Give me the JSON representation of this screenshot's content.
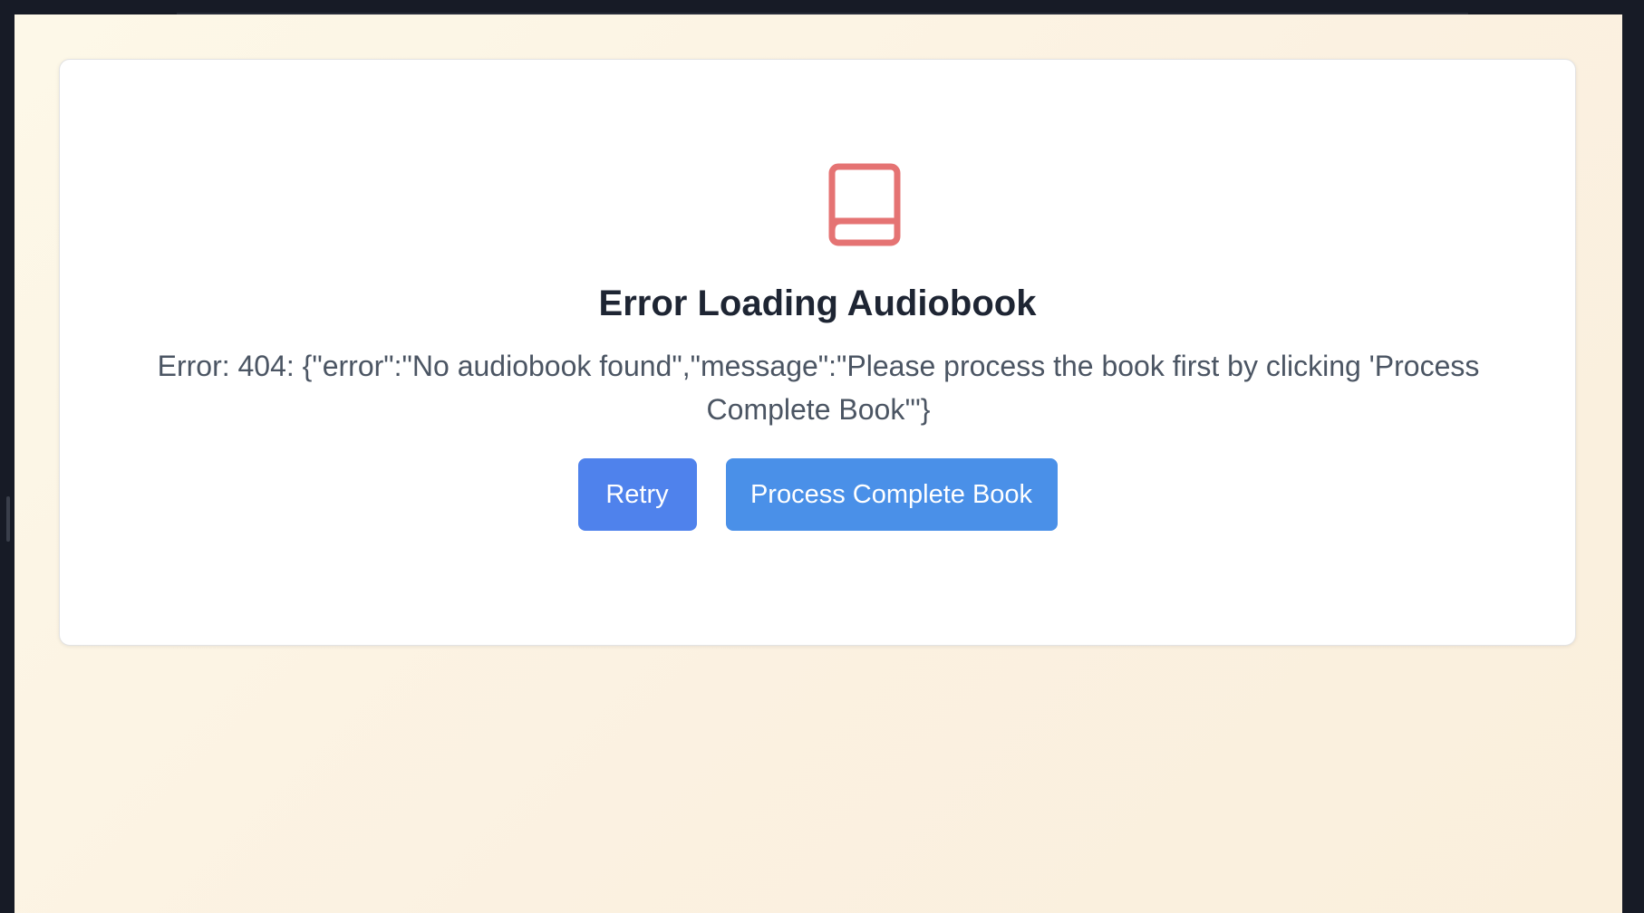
{
  "error_panel": {
    "icon": "book-icon",
    "icon_color": "#e57373",
    "title": "Error Loading Audiobook",
    "message": "Error: 404: {\"error\":\"No audiobook found\",\"message\":\"Please process the book first by clicking 'Process Complete Book'\"}"
  },
  "actions": {
    "retry_label": "Retry",
    "process_label": "Process Complete Book"
  },
  "colors": {
    "retry_button": "#4f82ec",
    "process_button": "#4a90e8",
    "title_text": "#1e2533",
    "message_text": "#4b5563"
  }
}
